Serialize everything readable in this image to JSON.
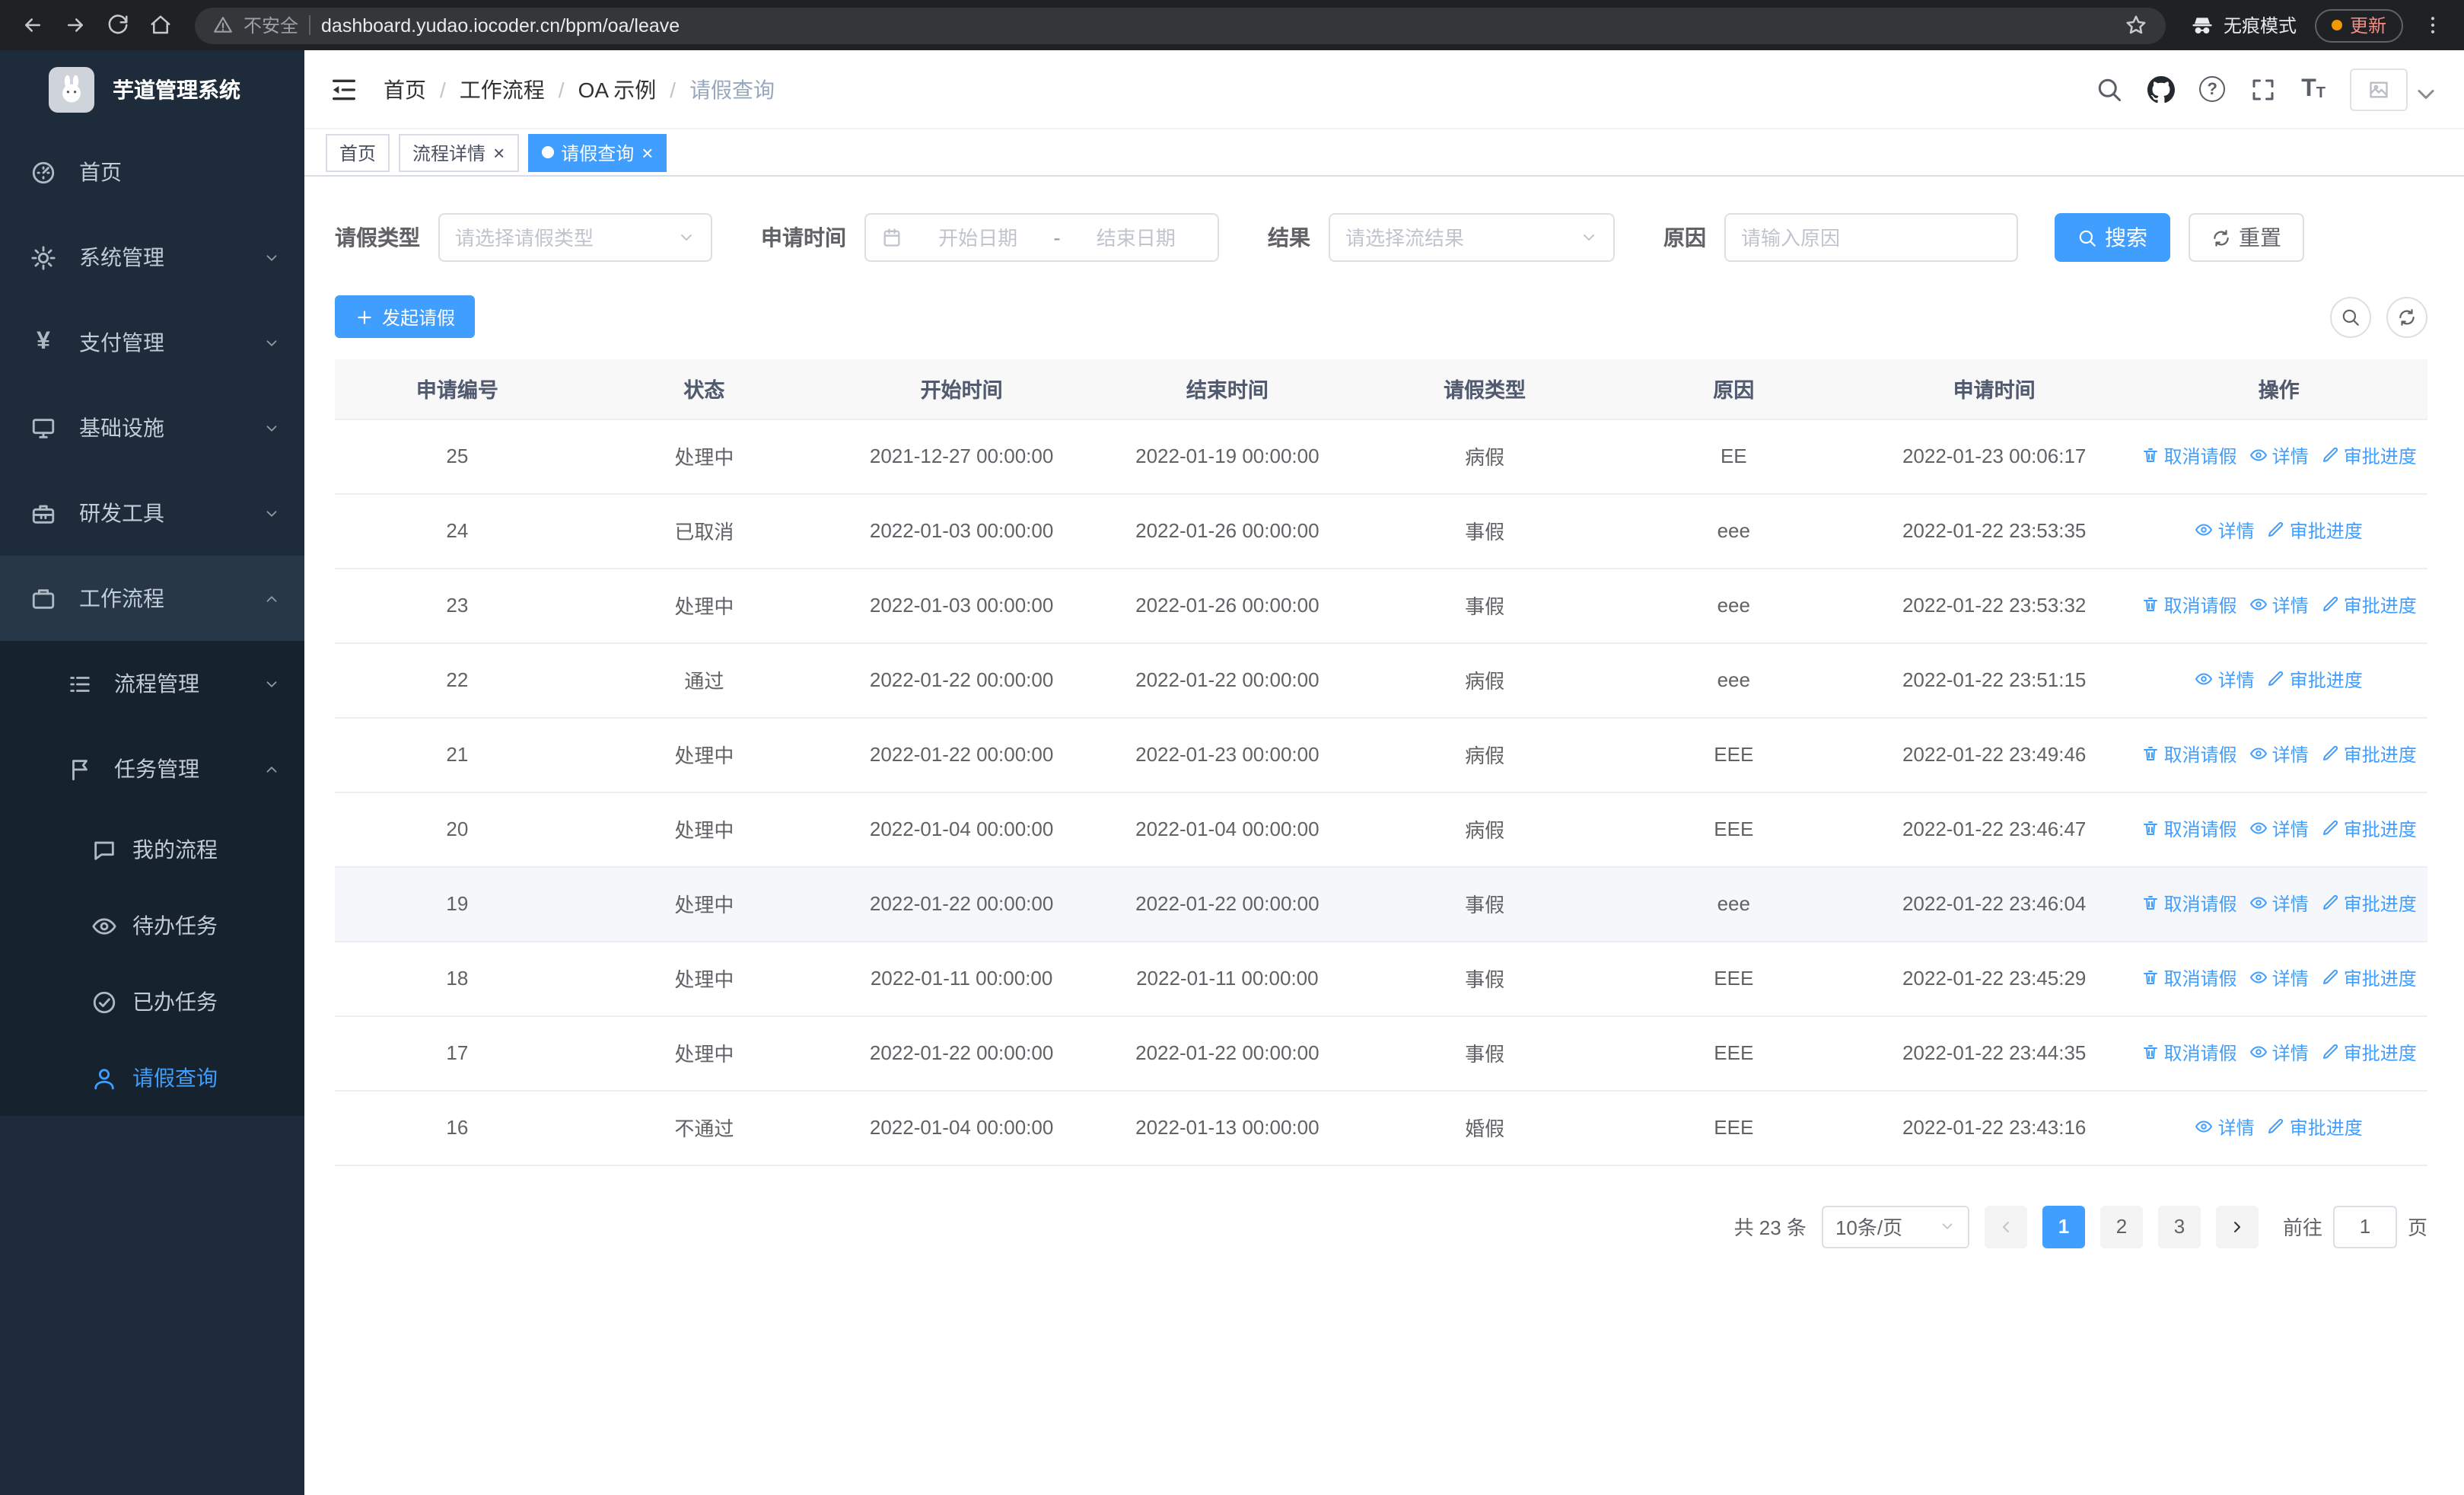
{
  "browser": {
    "security_label": "不安全",
    "url": "dashboard.yudao.iocoder.cn/bpm/oa/leave",
    "incognito_label": "无痕模式",
    "update_label": "更新"
  },
  "sidebar": {
    "app_title": "芋道管理系统",
    "items": [
      {
        "label": "首页",
        "icon": "dashboard-icon"
      },
      {
        "label": "系统管理",
        "icon": "gear-icon"
      },
      {
        "label": "支付管理",
        "icon": "yen-icon"
      },
      {
        "label": "基础设施",
        "icon": "monitor-icon"
      },
      {
        "label": "研发工具",
        "icon": "toolbox-icon"
      },
      {
        "label": "工作流程",
        "icon": "briefcase-icon"
      },
      {
        "label": "流程管理",
        "icon": "list-icon"
      },
      {
        "label": "任务管理",
        "icon": "flag-icon"
      },
      {
        "label": "我的流程",
        "icon": "chat-icon"
      },
      {
        "label": "待办任务",
        "icon": "eye-icon"
      },
      {
        "label": "已办任务",
        "icon": "check-circle-icon"
      },
      {
        "label": "请假查询",
        "icon": "user-icon"
      }
    ]
  },
  "header": {
    "breadcrumb": [
      "首页",
      "工作流程",
      "OA 示例",
      "请假查询"
    ]
  },
  "tabs": [
    {
      "label": "首页"
    },
    {
      "label": "流程详情"
    },
    {
      "label": "请假查询"
    }
  ],
  "filters": {
    "leave_type_label": "请假类型",
    "leave_type_placeholder": "请选择请假类型",
    "apply_time_label": "申请时间",
    "start_date_placeholder": "开始日期",
    "range_separator": "-",
    "end_date_placeholder": "结束日期",
    "result_label": "结果",
    "result_placeholder": "请选择流结果",
    "reason_label": "原因",
    "reason_placeholder": "请输入原因",
    "search_label": "搜索",
    "reset_label": "重置"
  },
  "toolbar": {
    "create_label": "发起请假"
  },
  "table": {
    "columns": [
      "申请编号",
      "状态",
      "开始时间",
      "结束时间",
      "请假类型",
      "原因",
      "申请时间",
      "操作"
    ],
    "rows": [
      {
        "id": "25",
        "status": "处理中",
        "start": "2021-12-27 00:00:00",
        "end": "2022-01-19 00:00:00",
        "type": "病假",
        "reason": "EE",
        "applied": "2022-01-23 00:06:17",
        "highlight": false,
        "actions": [
          {
            "label": "取消请假",
            "icon": "delete-icon"
          },
          {
            "label": "详情",
            "icon": "view-icon"
          },
          {
            "label": "审批进度",
            "icon": "edit-icon"
          }
        ]
      },
      {
        "id": "24",
        "status": "已取消",
        "start": "2022-01-03 00:00:00",
        "end": "2022-01-26 00:00:00",
        "type": "事假",
        "reason": "eee",
        "applied": "2022-01-22 23:53:35",
        "highlight": false,
        "actions": [
          {
            "label": "详情",
            "icon": "view-icon"
          },
          {
            "label": "审批进度",
            "icon": "edit-icon"
          }
        ]
      },
      {
        "id": "23",
        "status": "处理中",
        "start": "2022-01-03 00:00:00",
        "end": "2022-01-26 00:00:00",
        "type": "事假",
        "reason": "eee",
        "applied": "2022-01-22 23:53:32",
        "highlight": false,
        "actions": [
          {
            "label": "取消请假",
            "icon": "delete-icon"
          },
          {
            "label": "详情",
            "icon": "view-icon"
          },
          {
            "label": "审批进度",
            "icon": "edit-icon"
          }
        ]
      },
      {
        "id": "22",
        "status": "通过",
        "start": "2022-01-22 00:00:00",
        "end": "2022-01-22 00:00:00",
        "type": "病假",
        "reason": "eee",
        "applied": "2022-01-22 23:51:15",
        "highlight": false,
        "actions": [
          {
            "label": "详情",
            "icon": "view-icon"
          },
          {
            "label": "审批进度",
            "icon": "edit-icon"
          }
        ]
      },
      {
        "id": "21",
        "status": "处理中",
        "start": "2022-01-22 00:00:00",
        "end": "2022-01-23 00:00:00",
        "type": "病假",
        "reason": "EEE",
        "applied": "2022-01-22 23:49:46",
        "highlight": false,
        "actions": [
          {
            "label": "取消请假",
            "icon": "delete-icon"
          },
          {
            "label": "详情",
            "icon": "view-icon"
          },
          {
            "label": "审批进度",
            "icon": "edit-icon"
          }
        ]
      },
      {
        "id": "20",
        "status": "处理中",
        "start": "2022-01-04 00:00:00",
        "end": "2022-01-04 00:00:00",
        "type": "病假",
        "reason": "EEE",
        "applied": "2022-01-22 23:46:47",
        "highlight": false,
        "actions": [
          {
            "label": "取消请假",
            "icon": "delete-icon"
          },
          {
            "label": "详情",
            "icon": "view-icon"
          },
          {
            "label": "审批进度",
            "icon": "edit-icon"
          }
        ]
      },
      {
        "id": "19",
        "status": "处理中",
        "start": "2022-01-22 00:00:00",
        "end": "2022-01-22 00:00:00",
        "type": "事假",
        "reason": "eee",
        "applied": "2022-01-22 23:46:04",
        "highlight": true,
        "actions": [
          {
            "label": "取消请假",
            "icon": "delete-icon"
          },
          {
            "label": "详情",
            "icon": "view-icon"
          },
          {
            "label": "审批进度",
            "icon": "edit-icon"
          }
        ]
      },
      {
        "id": "18",
        "status": "处理中",
        "start": "2022-01-11 00:00:00",
        "end": "2022-01-11 00:00:00",
        "type": "事假",
        "reason": "EEE",
        "applied": "2022-01-22 23:45:29",
        "highlight": false,
        "actions": [
          {
            "label": "取消请假",
            "icon": "delete-icon"
          },
          {
            "label": "详情",
            "icon": "view-icon"
          },
          {
            "label": "审批进度",
            "icon": "edit-icon"
          }
        ]
      },
      {
        "id": "17",
        "status": "处理中",
        "start": "2022-01-22 00:00:00",
        "end": "2022-01-22 00:00:00",
        "type": "事假",
        "reason": "EEE",
        "applied": "2022-01-22 23:44:35",
        "highlight": false,
        "actions": [
          {
            "label": "取消请假",
            "icon": "delete-icon"
          },
          {
            "label": "详情",
            "icon": "view-icon"
          },
          {
            "label": "审批进度",
            "icon": "edit-icon"
          }
        ]
      },
      {
        "id": "16",
        "status": "不通过",
        "start": "2022-01-04 00:00:00",
        "end": "2022-01-13 00:00:00",
        "type": "婚假",
        "reason": "EEE",
        "applied": "2022-01-22 23:43:16",
        "highlight": false,
        "actions": [
          {
            "label": "详情",
            "icon": "view-icon"
          },
          {
            "label": "审批进度",
            "icon": "edit-icon"
          }
        ]
      }
    ]
  },
  "pagination": {
    "total_label": "共 23 条",
    "page_size_label": "10条/页",
    "pages": [
      "1",
      "2",
      "3"
    ],
    "active_page": "1",
    "goto_label": "前往",
    "goto_value": "1",
    "page_unit_label": "页"
  },
  "colors": {
    "primary": "#409eff",
    "sidebar_bg": "#1d2b3a",
    "sidebar_submenu_bg": "#16222e",
    "table_header_bg": "#f8f8f9"
  }
}
